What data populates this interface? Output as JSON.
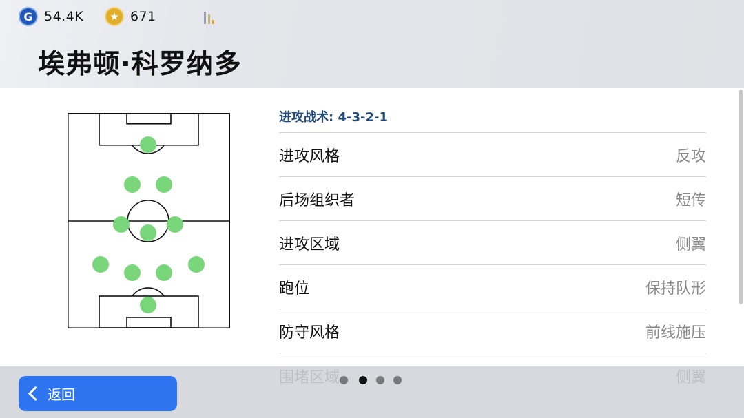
{
  "header": {
    "gp": {
      "icon": "g-coin-icon",
      "letter": "G",
      "value": "54.4K"
    },
    "coins": {
      "icon": "star-coin-icon",
      "value": "671"
    },
    "signal_icon": "signal-icon",
    "title": "埃弗顿·科罗纳多"
  },
  "formation": {
    "section_label": "进攻战术: 4-3-2-1",
    "pitch_icon": "pitch-diagram",
    "player_color": "#7ad67a"
  },
  "tactics": [
    {
      "label": "进攻风格",
      "value": "反攻"
    },
    {
      "label": "后场组织者",
      "value": "短传"
    },
    {
      "label": "进攻区域",
      "value": "侧翼"
    },
    {
      "label": "跑位",
      "value": "保持队形"
    },
    {
      "label": "防守风格",
      "value": "前线施压"
    }
  ],
  "partially_hidden": [
    {
      "label": "围堵区域",
      "value": "侧翼"
    }
  ],
  "footer": {
    "back_label": "返回",
    "page_count": 4,
    "active_page": 2
  },
  "colors": {
    "accent": "#2f74ef",
    "section_title": "#1f4a7a",
    "value_text": "#8a8a8a"
  }
}
